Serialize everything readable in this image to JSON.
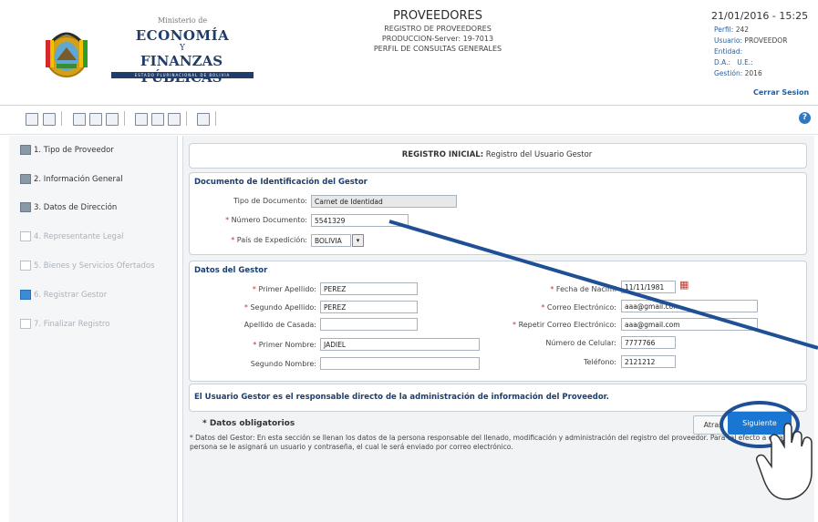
{
  "header": {
    "logo": {
      "ministry": "Ministerio de",
      "line1": "ECONOMÍA",
      "y": "Y",
      "line2": "FINANZAS PÚBLICAS",
      "bar_text": "ESTADO PLURINACIONAL DE BOLIVIA"
    },
    "title": "PROVEEDORES",
    "subtitle1": "REGISTRO DE PROVEEDORES",
    "subtitle2": "PRODUCCION-Server: 19-7013",
    "subtitle3": "PERFIL DE CONSULTAS GENERALES",
    "datetime": "21/01/2016 - 15:25",
    "perfil_label": "Perfil:",
    "perfil_value": "242",
    "usuario_label": "Usuario:",
    "usuario_value": "PROVEEDOR",
    "entidad_label": "Entidad:",
    "da_label": "D.A.:",
    "ue_label": "U.E.:",
    "gestion_label": "Gestión:",
    "gestion_value": "2016",
    "logout": "Cerrar Sesion"
  },
  "sidebar": {
    "items": [
      {
        "label": "1. Tipo de Proveedor",
        "state": "done"
      },
      {
        "label": "2. Información General",
        "state": "done"
      },
      {
        "label": "3. Datos de Dirección",
        "state": "done"
      },
      {
        "label": "4. Representante Legal",
        "state": "disabled"
      },
      {
        "label": "5. Bienes y Servicios Ofertados",
        "state": "disabled"
      },
      {
        "label": "6. Registrar Gestor",
        "state": "active"
      },
      {
        "label": "7. Finalizar Registro",
        "state": "disabled"
      }
    ]
  },
  "main": {
    "title_bold": "REGISTRO INICIAL:",
    "title_rest": " Registro del Usuario Gestor",
    "doc_section": {
      "title": "Documento de Identificación del Gestor",
      "tipo_label": "Tipo de Documento:",
      "tipo_value": "Carnet de Identidad",
      "numero_label": "Número Documento:",
      "numero_value": "5541329",
      "pais_label": "País de Expedición:",
      "pais_value": "BOLIVIA"
    },
    "gestor_section": {
      "title": "Datos del Gestor",
      "primer_apellido_label": "Primer Apellido:",
      "primer_apellido_value": "PEREZ",
      "segundo_apellido_label": "Segundo Apellido:",
      "segundo_apellido_value": "PEREZ",
      "apellido_casada_label": "Apellido de Casada:",
      "apellido_casada_value": "",
      "primer_nombre_label": "Primer Nombre:",
      "primer_nombre_value": "JADIEL",
      "segundo_nombre_label": "Segundo Nombre:",
      "segundo_nombre_value": "",
      "fecha_nac_label": "Fecha de Nacimi",
      "fecha_nac_value": "11/11/1981",
      "correo_label": "Correo Electrónico:",
      "correo_value": "aaa@gmail.com",
      "repetir_correo_label": "Repetir Correo Electrónico:",
      "repetir_correo_value": "aaa@gmail.com",
      "celular_label": "Número de Celular:",
      "celular_value": "7777766",
      "telefono_label": "Teléfono:",
      "telefono_value": "2121212"
    },
    "note_bold": "El Usuario Gestor es el responsable directo de la administración de información del Proveedor.",
    "obligatorios": "* Datos obligatorios",
    "note_text": "* Datos del Gestor: En esta sección se llenan los datos de la persona responsable del llenado, modificación y administración del registro del proveedor. Para tal efecto a esta persona se le asignará un usuario y contraseña, el cual le será enviado por correo electrónico.",
    "btn_back": "Atras",
    "btn_next": "Siguiente"
  },
  "colors": {
    "accent": "#1976d2",
    "section_title": "#1c3f6e",
    "required": "#d12b2b",
    "annotation": "#1f4f94"
  }
}
